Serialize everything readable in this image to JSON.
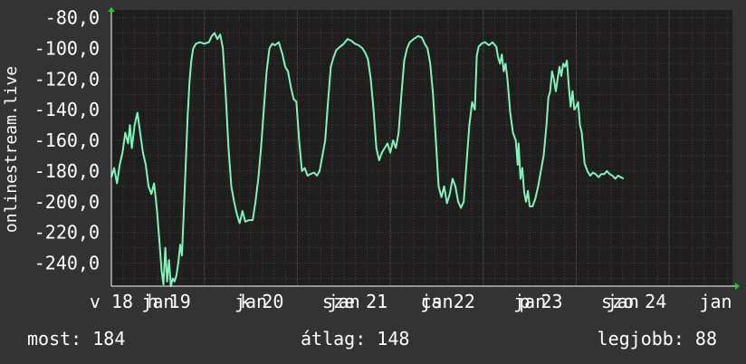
{
  "colors": {
    "background": "#333333",
    "plot_background": "#1e1e1e",
    "grid": "#4a3b3b",
    "line": "#7df5b8",
    "axis_arrow": "#22cc22",
    "text": "#ffffff"
  },
  "stats": {
    "current": "most: 184",
    "average": "átlag: 148",
    "best": "legjobb: 88"
  },
  "chart_data": {
    "type": "line",
    "ylabel": "onlinestream.live",
    "ylim": [
      -255,
      -75
    ],
    "xlim": [
      0,
      6.68
    ],
    "yticks": [
      {
        "value": -80,
        "label": "-80,0"
      },
      {
        "value": -100,
        "label": "-100,0"
      },
      {
        "value": -120,
        "label": "-120,0"
      },
      {
        "value": -140,
        "label": "-140,0"
      },
      {
        "value": -160,
        "label": "-160,0"
      },
      {
        "value": -180,
        "label": "-180,0"
      },
      {
        "value": -200,
        "label": "-200,0"
      },
      {
        "value": -220,
        "label": "-220,0"
      },
      {
        "value": -240,
        "label": "-240,0"
      }
    ],
    "xticks": [
      {
        "value": 0.0,
        "label": "v 18"
      },
      {
        "value": 0.5,
        "label": "jan"
      },
      {
        "value": 0.62,
        "label": "h 19"
      },
      {
        "value": 1.5,
        "label": "jan"
      },
      {
        "value": 1.62,
        "label": "k 20"
      },
      {
        "value": 2.5,
        "label": "jan"
      },
      {
        "value": 2.62,
        "label": "sze 21"
      },
      {
        "value": 3.5,
        "label": "jan"
      },
      {
        "value": 3.62,
        "label": "cs 22"
      },
      {
        "value": 4.5,
        "label": "jan"
      },
      {
        "value": 4.62,
        "label": "p 23"
      },
      {
        "value": 5.5,
        "label": "jan"
      },
      {
        "value": 5.62,
        "label": "szo 24"
      },
      {
        "value": 6.5,
        "label": "jan"
      }
    ],
    "series": [
      {
        "color": "#7df5b8",
        "points": [
          [
            0.0,
            -184
          ],
          [
            0.03,
            -178
          ],
          [
            0.06,
            -188
          ],
          [
            0.09,
            -176
          ],
          [
            0.12,
            -168
          ],
          [
            0.15,
            -155
          ],
          [
            0.18,
            -162
          ],
          [
            0.2,
            -150
          ],
          [
            0.22,
            -165
          ],
          [
            0.25,
            -150
          ],
          [
            0.28,
            -142
          ],
          [
            0.31,
            -155
          ],
          [
            0.34,
            -168
          ],
          [
            0.37,
            -176
          ],
          [
            0.4,
            -190
          ],
          [
            0.43,
            -195
          ],
          [
            0.46,
            -188
          ],
          [
            0.49,
            -205
          ],
          [
            0.52,
            -228
          ],
          [
            0.54,
            -245
          ],
          [
            0.56,
            -254
          ],
          [
            0.58,
            -230
          ],
          [
            0.6,
            -252
          ],
          [
            0.62,
            -238
          ],
          [
            0.64,
            -255
          ],
          [
            0.66,
            -250
          ],
          [
            0.68,
            -252
          ],
          [
            0.7,
            -248
          ],
          [
            0.72,
            -240
          ],
          [
            0.74,
            -228
          ],
          [
            0.76,
            -235
          ],
          [
            0.78,
            -205
          ],
          [
            0.8,
            -175
          ],
          [
            0.82,
            -145
          ],
          [
            0.84,
            -122
          ],
          [
            0.86,
            -108
          ],
          [
            0.88,
            -100
          ],
          [
            0.91,
            -97
          ],
          [
            0.95,
            -96
          ],
          [
            1.0,
            -97
          ],
          [
            1.05,
            -96
          ],
          [
            1.08,
            -92
          ],
          [
            1.11,
            -90
          ],
          [
            1.14,
            -94
          ],
          [
            1.17,
            -91
          ],
          [
            1.2,
            -100
          ],
          [
            1.23,
            -130
          ],
          [
            1.26,
            -165
          ],
          [
            1.29,
            -190
          ],
          [
            1.32,
            -200
          ],
          [
            1.35,
            -208
          ],
          [
            1.38,
            -214
          ],
          [
            1.41,
            -206
          ],
          [
            1.44,
            -213
          ],
          [
            1.48,
            -212
          ],
          [
            1.52,
            -212
          ],
          [
            1.55,
            -200
          ],
          [
            1.58,
            -185
          ],
          [
            1.61,
            -165
          ],
          [
            1.64,
            -140
          ],
          [
            1.67,
            -115
          ],
          [
            1.7,
            -100
          ],
          [
            1.73,
            -97
          ],
          [
            1.76,
            -98
          ],
          [
            1.8,
            -96
          ],
          [
            1.84,
            -104
          ],
          [
            1.87,
            -112
          ],
          [
            1.9,
            -115
          ],
          [
            1.93,
            -125
          ],
          [
            1.96,
            -133
          ],
          [
            1.99,
            -135
          ],
          [
            2.02,
            -160
          ],
          [
            2.05,
            -180
          ],
          [
            2.08,
            -178
          ],
          [
            2.11,
            -183
          ],
          [
            2.14,
            -182
          ],
          [
            2.18,
            -181
          ],
          [
            2.21,
            -183
          ],
          [
            2.24,
            -180
          ],
          [
            2.27,
            -170
          ],
          [
            2.3,
            -160
          ],
          [
            2.33,
            -135
          ],
          [
            2.36,
            -112
          ],
          [
            2.39,
            -106
          ],
          [
            2.42,
            -101
          ],
          [
            2.46,
            -99
          ],
          [
            2.5,
            -97
          ],
          [
            2.54,
            -94
          ],
          [
            2.58,
            -95
          ],
          [
            2.62,
            -97
          ],
          [
            2.66,
            -98
          ],
          [
            2.7,
            -100
          ],
          [
            2.73,
            -103
          ],
          [
            2.76,
            -107
          ],
          [
            2.79,
            -120
          ],
          [
            2.82,
            -140
          ],
          [
            2.85,
            -165
          ],
          [
            2.88,
            -173
          ],
          [
            2.91,
            -168
          ],
          [
            2.94,
            -165
          ],
          [
            2.97,
            -162
          ],
          [
            3.0,
            -168
          ],
          [
            3.03,
            -160
          ],
          [
            3.06,
            -165
          ],
          [
            3.09,
            -155
          ],
          [
            3.12,
            -130
          ],
          [
            3.15,
            -108
          ],
          [
            3.18,
            -100
          ],
          [
            3.21,
            -96
          ],
          [
            3.25,
            -94
          ],
          [
            3.3,
            -92
          ],
          [
            3.34,
            -93
          ],
          [
            3.37,
            -97
          ],
          [
            3.4,
            -100
          ],
          [
            3.43,
            -110
          ],
          [
            3.46,
            -130
          ],
          [
            3.49,
            -160
          ],
          [
            3.52,
            -190
          ],
          [
            3.55,
            -197
          ],
          [
            3.58,
            -190
          ],
          [
            3.61,
            -201
          ],
          [
            3.64,
            -195
          ],
          [
            3.67,
            -185
          ],
          [
            3.7,
            -190
          ],
          [
            3.73,
            -200
          ],
          [
            3.76,
            -204
          ],
          [
            3.79,
            -200
          ],
          [
            3.82,
            -175
          ],
          [
            3.85,
            -150
          ],
          [
            3.88,
            -135
          ],
          [
            3.91,
            -140
          ],
          [
            3.93,
            -105
          ],
          [
            3.95,
            -99
          ],
          [
            3.98,
            -97
          ],
          [
            4.02,
            -96
          ],
          [
            4.06,
            -98
          ],
          [
            4.1,
            -96
          ],
          [
            4.14,
            -99
          ],
          [
            4.16,
            -106
          ],
          [
            4.18,
            -110
          ],
          [
            4.2,
            -104
          ],
          [
            4.22,
            -115
          ],
          [
            4.24,
            -110
          ],
          [
            4.26,
            -120
          ],
          [
            4.29,
            -142
          ],
          [
            4.32,
            -155
          ],
          [
            4.35,
            -160
          ],
          [
            4.37,
            -176
          ],
          [
            4.38,
            -162
          ],
          [
            4.4,
            -185
          ],
          [
            4.42,
            -178
          ],
          [
            4.44,
            -194
          ],
          [
            4.46,
            -200
          ],
          [
            4.48,
            -193
          ],
          [
            4.5,
            -203
          ],
          [
            4.53,
            -203
          ],
          [
            4.56,
            -198
          ],
          [
            4.59,
            -190
          ],
          [
            4.62,
            -180
          ],
          [
            4.65,
            -170
          ],
          [
            4.68,
            -150
          ],
          [
            4.7,
            -132
          ],
          [
            4.72,
            -128
          ],
          [
            4.74,
            -115
          ],
          [
            4.76,
            -120
          ],
          [
            4.78,
            -128
          ],
          [
            4.8,
            -120
          ],
          [
            4.82,
            -112
          ],
          [
            4.84,
            -118
          ],
          [
            4.86,
            -110
          ],
          [
            4.88,
            -112
          ],
          [
            4.9,
            -108
          ],
          [
            4.92,
            -125
          ],
          [
            4.94,
            -138
          ],
          [
            4.96,
            -128
          ],
          [
            4.98,
            -140
          ],
          [
            5.0,
            -138
          ],
          [
            5.02,
            -135
          ],
          [
            5.04,
            -150
          ],
          [
            5.06,
            -155
          ],
          [
            5.09,
            -175
          ],
          [
            5.12,
            -180
          ],
          [
            5.15,
            -183
          ],
          [
            5.18,
            -181
          ],
          [
            5.21,
            -182
          ],
          [
            5.24,
            -184
          ],
          [
            5.27,
            -182
          ],
          [
            5.3,
            -182
          ],
          [
            5.33,
            -180
          ],
          [
            5.36,
            -182
          ],
          [
            5.39,
            -183
          ],
          [
            5.42,
            -185
          ],
          [
            5.45,
            -183
          ],
          [
            5.48,
            -184
          ],
          [
            5.51,
            -185
          ]
        ]
      }
    ]
  }
}
